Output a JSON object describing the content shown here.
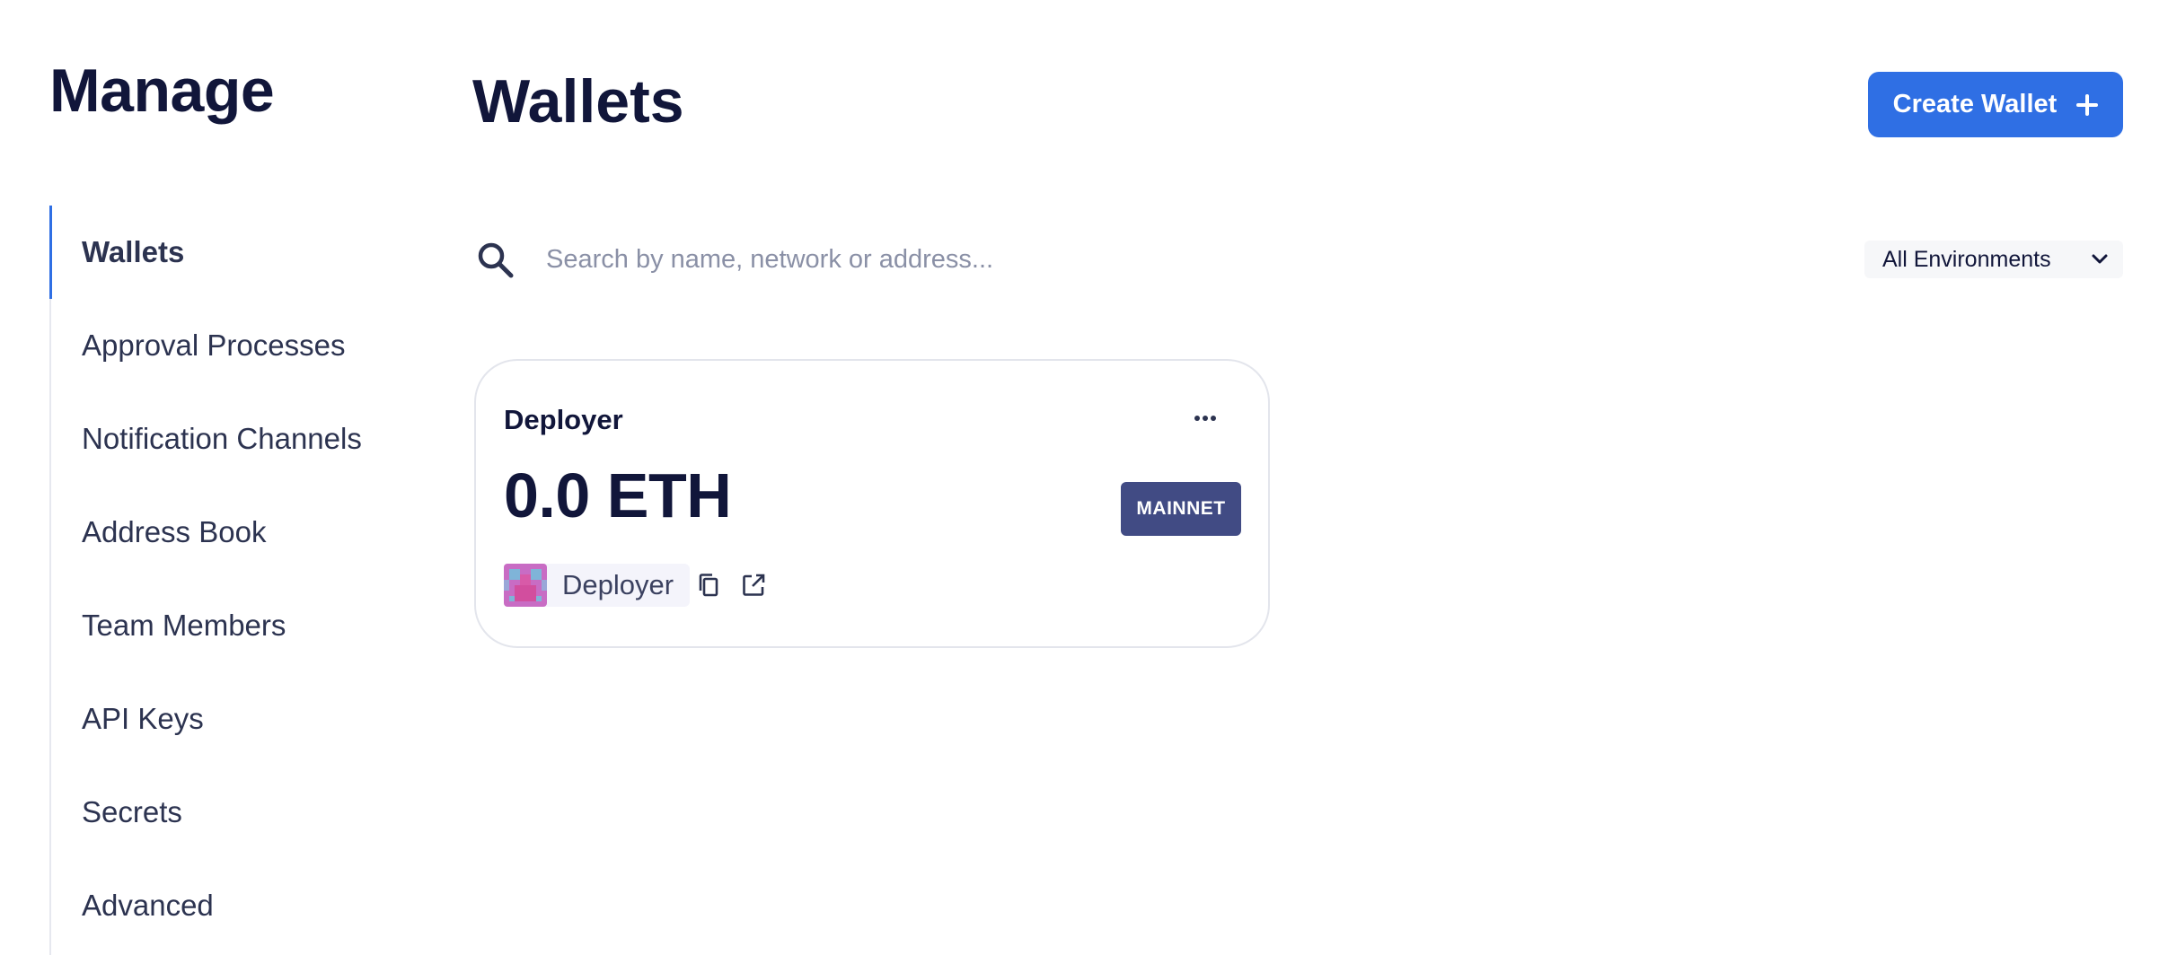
{
  "sidebar": {
    "title": "Manage",
    "items": [
      {
        "label": "Wallets",
        "active": true
      },
      {
        "label": "Approval Processes"
      },
      {
        "label": "Notification Channels"
      },
      {
        "label": "Address Book"
      },
      {
        "label": "Team Members"
      },
      {
        "label": "API Keys"
      },
      {
        "label": "Secrets"
      },
      {
        "label": "Advanced"
      }
    ]
  },
  "header": {
    "title": "Wallets",
    "create_label": "Create Wallet"
  },
  "search": {
    "placeholder": "Search by name, network or address..."
  },
  "filter": {
    "selected": "All Environments"
  },
  "wallets": [
    {
      "name": "Deployer",
      "balance": "0.0 ETH",
      "network": "MAINNET",
      "address_label": "Deployer"
    }
  ],
  "colors": {
    "accent": "#2f6fe4",
    "badge": "#414b84",
    "text": "#11163a"
  }
}
